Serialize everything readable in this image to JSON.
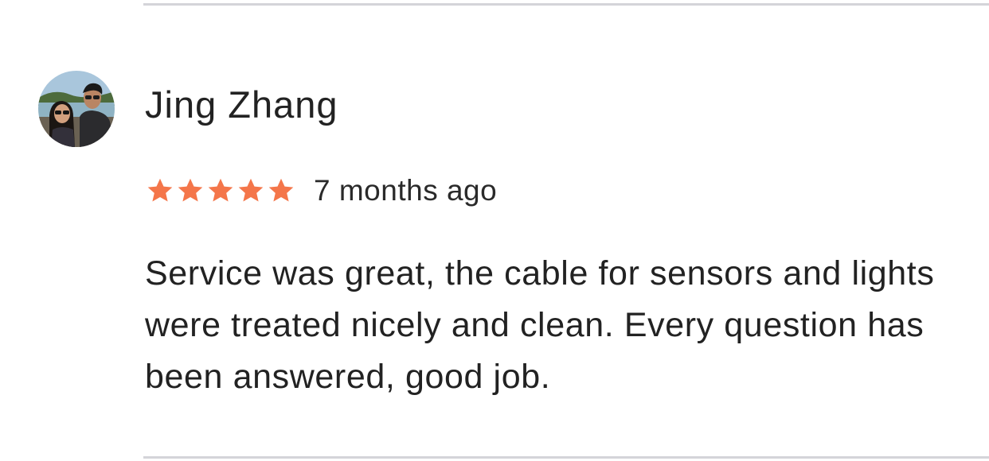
{
  "review": {
    "reviewer_name": "Jing Zhang",
    "rating": 5,
    "rating_max": 5,
    "time_ago": "7 months ago",
    "text": "Service was great, the cable for sensors and lights were treated nicely and clean. Every question has been answered, good job.",
    "avatar_icon": "user-photo-avatar"
  },
  "colors": {
    "star": "#f4764a",
    "text": "#222222",
    "divider": "#d4d4d9"
  }
}
